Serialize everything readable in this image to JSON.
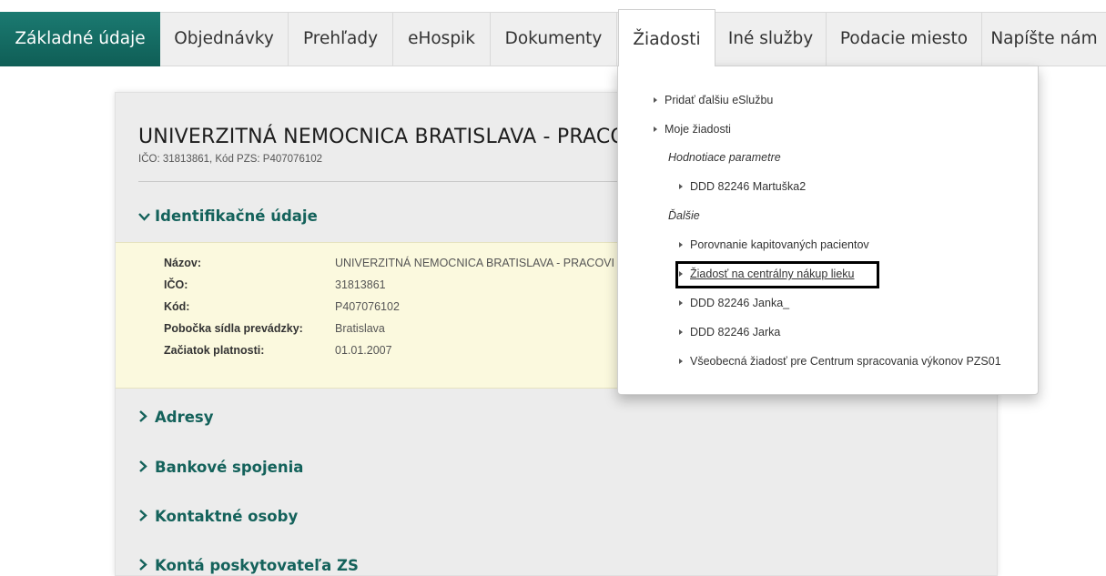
{
  "nav": {
    "tabs": [
      {
        "label": "Základné údaje"
      },
      {
        "label": "Objednávky"
      },
      {
        "label": "Prehľady"
      },
      {
        "label": "eHospik"
      },
      {
        "label": "Dokumenty"
      },
      {
        "label": "Žiadosti"
      },
      {
        "label": "Iné služby"
      },
      {
        "label": "Podacie miesto"
      },
      {
        "label": "Napíšte nám"
      }
    ],
    "colors": {
      "active": "#136a62"
    }
  },
  "page": {
    "title": "UNIVERZITNÁ NEMOCNICA BRATISLAVA - PRACOVI",
    "subtitle": "IČO: 31813861, Kód PZS: P407076102",
    "identification": {
      "heading": "Identifikačné údaje",
      "chevron": "chevron-down-icon",
      "rows": [
        {
          "label": "Názov:",
          "value": "UNIVERZITNÁ NEMOCNICA BRATISLAVA - PRACOVI"
        },
        {
          "label": "IČO:",
          "value": "31813861"
        },
        {
          "label": "Kód:",
          "value": "P407076102"
        },
        {
          "label": "Pobočka sídla prevádzky:",
          "value": "Bratislava"
        },
        {
          "label": "Začiatok platnosti:",
          "value": "01.01.2007"
        }
      ]
    },
    "sections": [
      {
        "label": "Adresy"
      },
      {
        "label": "Bankové spojenia"
      },
      {
        "label": "Kontaktné osoby"
      },
      {
        "label": "Kontá poskytovateľa ZS"
      }
    ]
  },
  "dropdown": {
    "items": {
      "add": "Pridať ďalšiu eSlužbu",
      "my_requests": "Moje žiadosti",
      "heading_params": "Hodnotiace parametre",
      "ddd_martuska": "DDD 82246 Martuška2",
      "heading_other": "Ďalšie",
      "porovnanie": "Porovnanie kapitovaných pacientov",
      "central": "Žiadosť na centrálny nákup lieku",
      "janka": "DDD 82246 Janka_",
      "jarka": "DDD 82246 Jarka",
      "vseobecna": "Všeobecná žiadosť pre Centrum spracovania výkonov PZS01"
    }
  }
}
